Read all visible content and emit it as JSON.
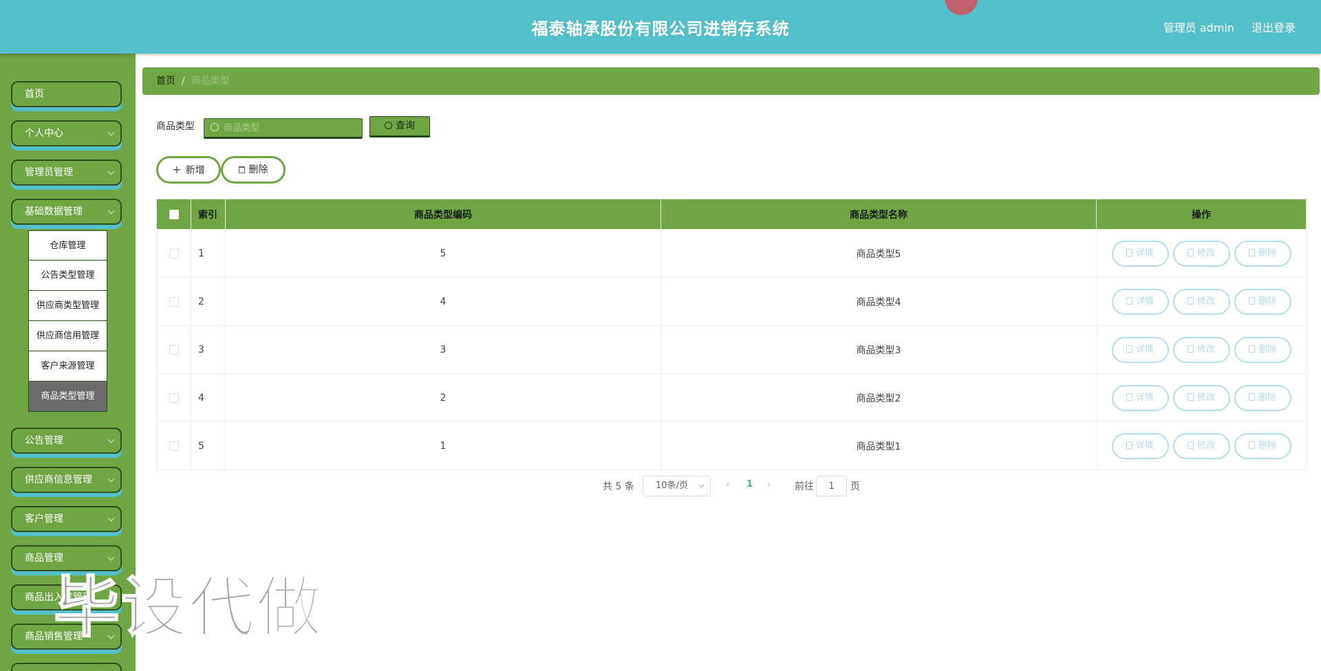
{
  "header": {
    "title": "福泰轴承股份有限公司进销存系统",
    "user": "管理员 admin",
    "logout": "退出登录"
  },
  "sidebar": {
    "items": [
      {
        "label": "首页"
      },
      {
        "label": "个人中心"
      },
      {
        "label": "管理员管理"
      },
      {
        "label": "基础数据管理"
      },
      {
        "label": "公告管理"
      },
      {
        "label": "供应商信息管理"
      },
      {
        "label": "客户管理"
      },
      {
        "label": "商品管理"
      },
      {
        "label": "商品出入库管理"
      },
      {
        "label": "商品销售管理"
      }
    ],
    "submenu": [
      {
        "label": "仓库管理"
      },
      {
        "label": "公告类型管理"
      },
      {
        "label": "供应商类型管理"
      },
      {
        "label": "供应商信用管理"
      },
      {
        "label": "客户来源管理"
      },
      {
        "label": "商品类型管理"
      }
    ]
  },
  "breadcrumb": {
    "home": "首页",
    "separator": "/",
    "current": "商品类型"
  },
  "search": {
    "label": "商品类型",
    "placeholder": "商品类型",
    "button": "查询"
  },
  "actions": {
    "add": "新增",
    "delete": "删除"
  },
  "table": {
    "headers": {
      "index": "索引",
      "code": "商品类型编码",
      "name": "商品类型名称",
      "ops": "操作"
    },
    "rows": [
      {
        "index": "1",
        "code": "5",
        "name": "商品类型5"
      },
      {
        "index": "2",
        "code": "4",
        "name": "商品类型4"
      },
      {
        "index": "3",
        "code": "3",
        "name": "商品类型3"
      },
      {
        "index": "4",
        "code": "2",
        "name": "商品类型2"
      },
      {
        "index": "5",
        "code": "1",
        "name": "商品类型1"
      }
    ],
    "row_actions": {
      "detail": "详情",
      "edit": "修改",
      "delete": "删除"
    }
  },
  "pagination": {
    "total": "共 5 条",
    "page_size": "10条/页",
    "current_page": "1",
    "goto": "前往",
    "goto_value": "1",
    "page_unit": "页"
  },
  "watermark": "毕设代做",
  "colors": {
    "header": "#53bfcb",
    "sidebar": "#6ea644",
    "accent_shadow": "#53bfcb",
    "active_submenu": "#6b6b6b",
    "row_action": "#b5dcea"
  }
}
